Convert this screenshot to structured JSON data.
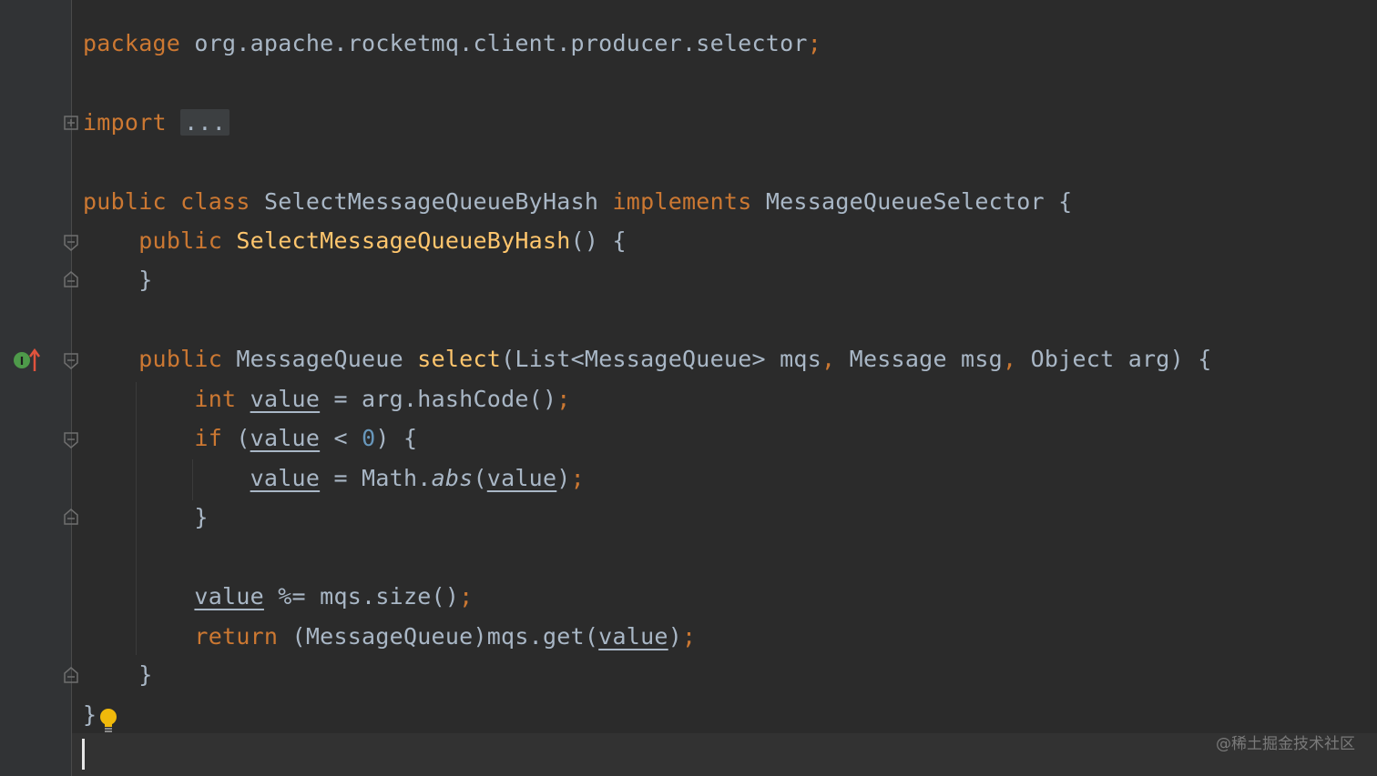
{
  "editor": {
    "lines": {
      "package": {
        "kw": "package",
        "name": "org.apache.rocketmq.client.producer.selector",
        "semi": ";"
      },
      "import": {
        "kw": "import",
        "fold": "..."
      },
      "class_decl": {
        "kw1": "public",
        "kw2": "class",
        "name": "SelectMessageQueueByHash",
        "kw3": "implements",
        "iface": "MessageQueueSelector",
        "brace": "{"
      },
      "ctor": {
        "kw": "public",
        "name": "SelectMessageQueueByHash",
        "rest": "() {"
      },
      "ctor_close": {
        "text": "}"
      },
      "method": {
        "kw": "public",
        "ret": "MessageQueue",
        "name": "select",
        "p1": "(List<MessageQueue> mqs",
        "c1": ",",
        "p2": " Message msg",
        "c2": ",",
        "p3": " Object arg) {"
      },
      "int_line": {
        "kw": "int",
        "var": "value",
        "mid": " = arg.hashCode()",
        "semi": ";"
      },
      "if_line": {
        "kw": "if",
        "open": " (",
        "var": "value",
        "mid": " < ",
        "num": "0",
        "close": ") {"
      },
      "abs_line": {
        "var": "value",
        "mid": " = Math.",
        "fn": "abs",
        "open": "(",
        "var2": "value",
        "close": ")",
        "semi": ";"
      },
      "if_close": {
        "text": "}"
      },
      "mod_line": {
        "var": "value",
        "mid": " %= mqs.size()",
        "semi": ";"
      },
      "return_line": {
        "kw": "return",
        "mid": " (MessageQueue)mqs.get(",
        "var": "value",
        "close": ")",
        "semi": ";"
      },
      "method_close": {
        "text": "}"
      },
      "class_close": {
        "text": "}"
      }
    },
    "implements_marker_letter": "I",
    "colors": {
      "background": "#2b2b2b",
      "keyword": "#cc7832",
      "function": "#ffc66d",
      "text": "#a9b7c6",
      "number": "#6897bb"
    },
    "icons": [
      "implements-method-icon",
      "fold-icon",
      "lightbulb-icon"
    ]
  },
  "watermark": "@稀土掘金技术社区"
}
